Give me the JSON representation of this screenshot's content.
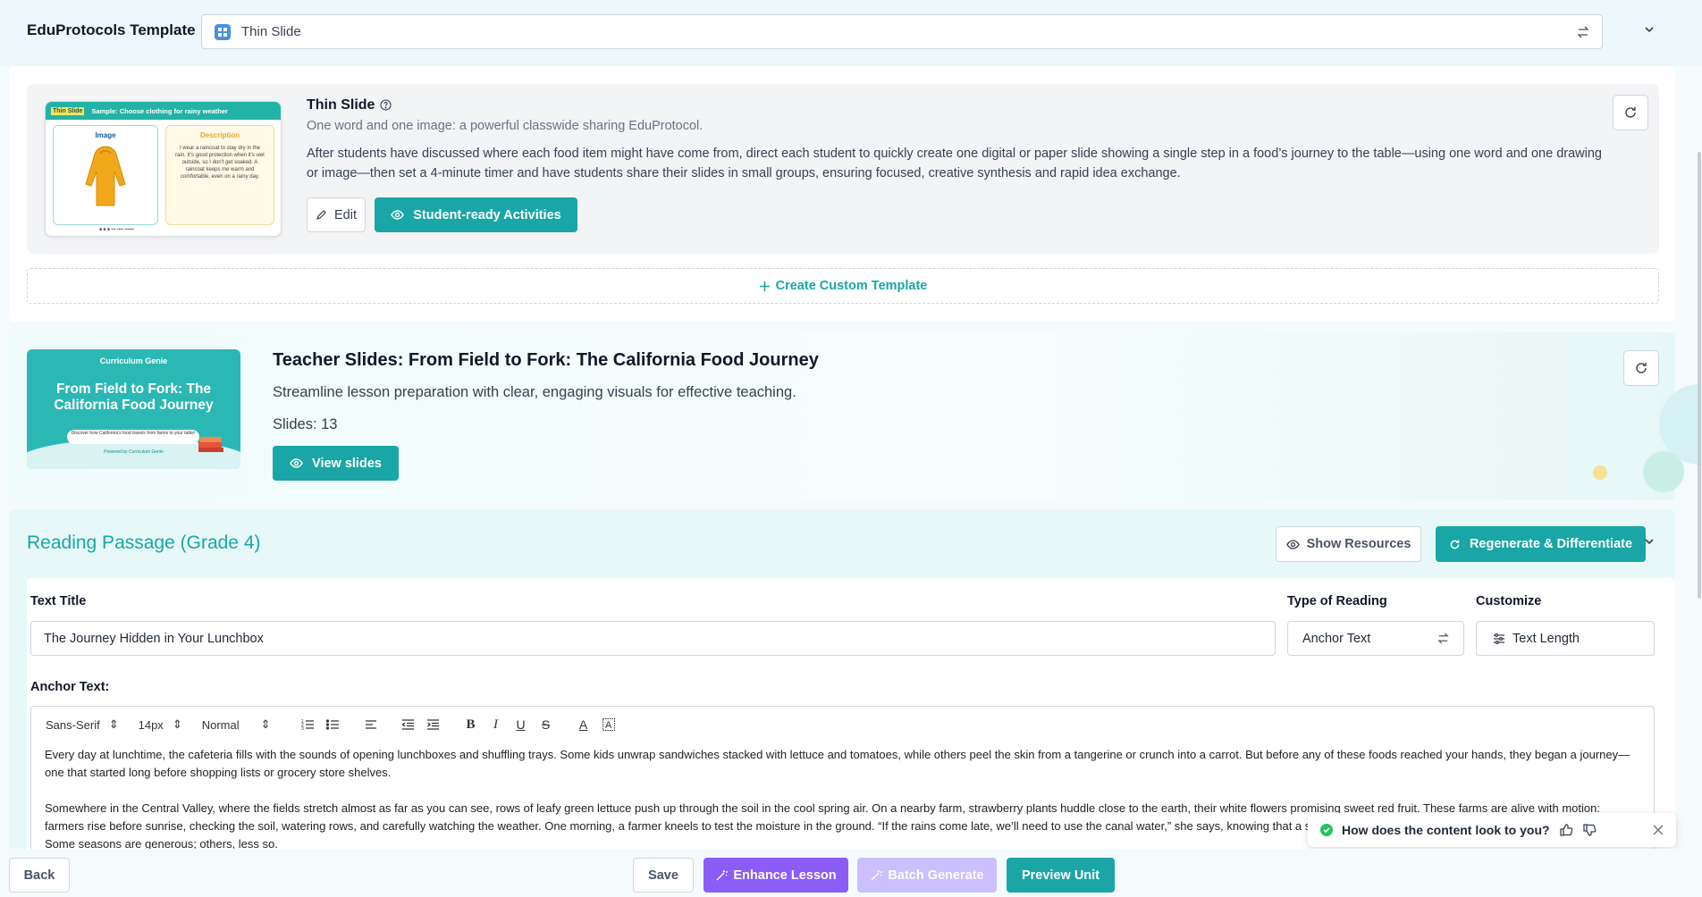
{
  "template_bar": {
    "label": "EduProtocols Template",
    "selected": "Thin Slide"
  },
  "thin_slide": {
    "thumbnail": {
      "tag": "Thin Slide",
      "header": "Sample: Choose clothing for rainy weather",
      "image_label": "Image",
      "description_label": "Description",
      "description_text": "I wear a raincoat to stay dry in the rain. It's good protection when it's wet outside, so I don't get soaked. A raincoat keeps me warm and comfortable, even on a rainy day."
    },
    "title": "Thin Slide",
    "subtitle": "One word and one image: a powerful classwide sharing EduProtocol.",
    "description": "After students have discussed where each food item might have come from, direct each student to quickly create one digital or paper slide showing a single step in a food’s journey to the table—using one word and one drawing or image—then set a 4-minute timer and have students share their slides in small groups, ensuring focused, creative synthesis and rapid idea exchange.",
    "edit_label": "Edit",
    "activities_label": "Student-ready Activities",
    "create_custom_label": "Create Custom Template"
  },
  "teacher_slides": {
    "thumbnail": {
      "brand": "Curriculum Genie",
      "title": "From Field to Fork: The California Food Journey",
      "pill": "Discover how California's food travels from farms to your table!",
      "powered": "Powered by Curriculum Genie"
    },
    "title": "Teacher Slides: From Field to Fork: The California Food Journey",
    "subtitle": "Streamline lesson preparation with clear, engaging visuals for effective teaching.",
    "slides_count": "Slides: 13",
    "view_label": "View slides"
  },
  "reading_passage": {
    "title": "Reading Passage (Grade 4)",
    "show_resources_label": "Show Resources",
    "regenerate_label": "Regenerate & Differentiate",
    "text_title_label": "Text Title",
    "text_title_value": "The Journey Hidden in Your Lunchbox",
    "type_label": "Type of Reading",
    "type_value": "Anchor Text",
    "customize_label": "Customize",
    "customize_value": "Text Length",
    "anchor_label": "Anchor Text:",
    "toolbar": {
      "font": "Sans-Serif",
      "size": "14px",
      "style": "Normal"
    },
    "paragraphs": [
      "Every day at lunchtime, the cafeteria fills with the sounds of opening lunchboxes and shuffling trays. Some kids unwrap sandwiches stacked with lettuce and tomatoes, while others peel the skin from a tangerine or crunch into a carrot. But before any of these foods reached your hands, they began a journey—one that started long before shopping lists or grocery store shelves.",
      "Somewhere in the Central Valley, where the fields stretch almost as far as you can see, rows of leafy green lettuce push up through the soil in the cool spring air. On a nearby farm, strawberry plants huddle close to the earth, their white flowers promising sweet red fruit. These farms are alive with motion: farmers rise before sunrise, checking the soil, watering rows, and carefully watching the weather. One morning, a farmer kneels to test the moisture in the ground. “If the rains come late, we’ll need to use the canal water,” she says, knowing that a single storm or the arrival of a cold snap changes everything. Some seasons are generous; others, less so."
    ]
  },
  "feedback": {
    "question": "How does the content look to you?"
  },
  "bottom_bar": {
    "back_label": "Back",
    "save_label": "Save",
    "enhance_label": "Enhance Lesson",
    "batch_label": "Batch Generate",
    "preview_label": "Preview Unit"
  },
  "colors": {
    "accent": "#1aa6a6",
    "purple": "#8b5cf6",
    "purple_disabled": "#c4b5fd"
  }
}
